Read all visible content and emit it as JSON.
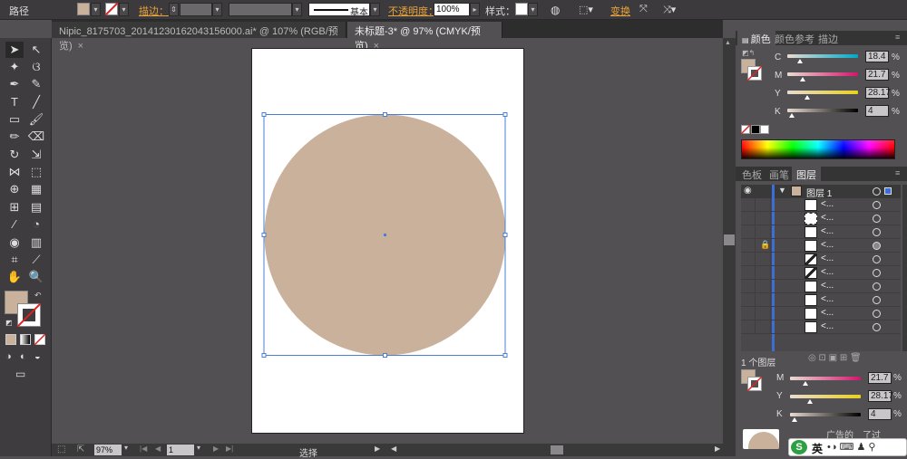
{
  "control_bar": {
    "mode_label": "路径",
    "stroke_label": "描边：",
    "stroke_style": "基本",
    "opacity_label": "不透明度：",
    "opacity_value": "100%",
    "style_label": "样式：",
    "transform_label": "变换"
  },
  "tabs": [
    {
      "label": "Nipic_8175703_20141230162043156000.ai* @ 107% (RGB/预览)",
      "close": "×"
    },
    {
      "label": "未标题-3* @ 97% (CMYK/预览)",
      "close": "×"
    }
  ],
  "color_panel": {
    "tabs": [
      "颜色",
      "颜色参考",
      "描边"
    ],
    "sliders": [
      {
        "label": "C",
        "value": "18.4"
      },
      {
        "label": "M",
        "value": "21.7"
      },
      {
        "label": "Y",
        "value": "28.17"
      },
      {
        "label": "K",
        "value": "4"
      }
    ],
    "percent": "%"
  },
  "layers_panel": {
    "tabs": [
      "色板",
      "画笔",
      "图层"
    ],
    "layer_name": "图层 1",
    "sublayer_label": "<...",
    "footer_count": "1 个图层"
  },
  "color_panel_2": {
    "sliders": [
      {
        "label": "M",
        "value": "21.7"
      },
      {
        "label": "Y",
        "value": "28.17"
      },
      {
        "label": "K",
        "value": "4"
      }
    ],
    "partial_label": "广告的",
    "partial_label_2": "了过"
  },
  "status_bar": {
    "zoom": "97%",
    "page": "1",
    "tool_name": "选择"
  },
  "ime": {
    "lang": "英"
  },
  "colors": {
    "fill": "#c9b19b",
    "selection": "#4a7fd6"
  }
}
